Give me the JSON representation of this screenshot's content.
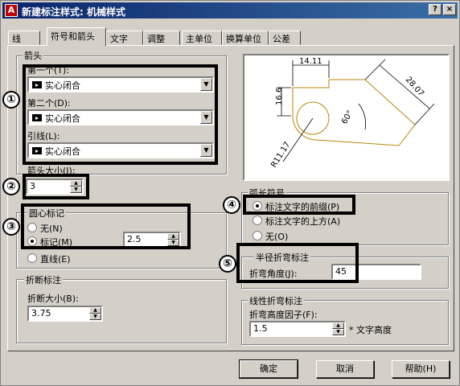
{
  "window": {
    "title": "新建标注样式: 机械样式",
    "help_button": "?",
    "close_button": "×"
  },
  "tabs": [
    {
      "label": "线",
      "active": false
    },
    {
      "label": "符号和箭头",
      "active": true
    },
    {
      "label": "文字",
      "active": false
    },
    {
      "label": "调整",
      "active": false
    },
    {
      "label": "主单位",
      "active": false
    },
    {
      "label": "换算单位",
      "active": false
    },
    {
      "label": "公差",
      "active": false
    }
  ],
  "arrows": {
    "group_label": "箭头",
    "first_label": "第一个(T):",
    "first_value": "实心闭合",
    "second_label": "第二个(D):",
    "second_value": "实心闭合",
    "leader_label": "引线(L):",
    "leader_value": "实心闭合",
    "size_label": "箭头大小(I):",
    "size_value": "3"
  },
  "center_marks": {
    "group_label": "圆心标记",
    "none_label": "无(N)",
    "mark_label": "标记(M)",
    "line_label": "直线(E)",
    "selected": "mark",
    "size_value": "2.5"
  },
  "break": {
    "group_label": "折断标注",
    "size_label": "折断大小(B):",
    "size_value": "3.75"
  },
  "arc_length": {
    "group_label": "弧长符号",
    "prefix_label": "标注文字的前缀(P)",
    "above_label": "标注文字的上方(A)",
    "none_label": "无(O)",
    "selected": "prefix"
  },
  "radius_jog": {
    "group_label": "半径折弯标注",
    "angle_label": "折弯角度(J):",
    "angle_value": "45"
  },
  "linear_jog": {
    "group_label": "线性折弯标注",
    "factor_label": "折弯高度因子(F):",
    "factor_value": "1.5",
    "factor_suffix": "* 文字高度"
  },
  "preview": {
    "dim_top": "14.11",
    "dim_left": "16.6",
    "dim_right": "28.07",
    "dim_angle": "60°",
    "dim_radius": "R11.17"
  },
  "annotations": [
    "①",
    "②",
    "③",
    "④",
    "⑤"
  ],
  "buttons": {
    "ok": "确定",
    "cancel": "取消",
    "help": "帮助(H)"
  },
  "colors": {
    "title_start": "#0a246a",
    "title_end": "#3a6ea5",
    "dialog_bg": "#d4d0c8",
    "preview_lines": "#b8860b"
  }
}
